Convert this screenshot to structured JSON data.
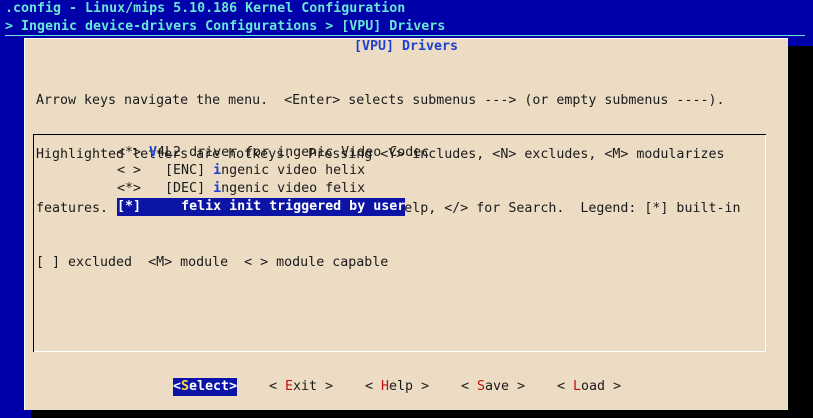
{
  "header": {
    "title": ".config - Linux/mips 5.10.186 Kernel Configuration",
    "breadcrumb": "> Ingenic device-drivers Configurations > [VPU] Drivers"
  },
  "dialog": {
    "title": "[VPU] Drivers",
    "help_lines": [
      "Arrow keys navigate the menu.  <Enter> selects submenus ---> (or empty submenus ----).",
      "Highlighted letters are hotkeys.  Pressing <Y> includes, <N> excludes, <M> modularizes",
      "features.  Press <Esc><Esc> to exit, <?> for Help, </> for Search.  Legend: [*] built-in",
      "[ ] excluded  <M> module  < > module capable"
    ]
  },
  "menu": {
    "items": [
      {
        "state": "<*> ",
        "prefix": "",
        "hotkey": "V",
        "rest": "4L2 driver for ingenic Video Codec"
      },
      {
        "state": "< > ",
        "prefix": "  [ENC] ",
        "hotkey": "i",
        "rest": "ngenic video helix"
      },
      {
        "state": "<*> ",
        "prefix": "  [DEC] ",
        "hotkey": "i",
        "rest": "ngenic video felix"
      },
      {
        "state": "[*] ",
        "prefix": "    ",
        "hotkey": "f",
        "rest": "elix init triggered by user"
      }
    ],
    "selected_index": 3
  },
  "buttons": [
    {
      "pre": "<",
      "hotkey": "S",
      "rest": "elect",
      "post": ">",
      "active": true
    },
    {
      "pre": "< ",
      "hotkey": "E",
      "rest": "xit",
      "post": " >",
      "active": false
    },
    {
      "pre": "< ",
      "hotkey": "H",
      "rest": "elp",
      "post": " >",
      "active": false
    },
    {
      "pre": "< ",
      "hotkey": "S",
      "rest": "ave",
      "post": " >",
      "active": false
    },
    {
      "pre": "< ",
      "hotkey": "L",
      "rest": "oad",
      "post": " >",
      "active": false
    }
  ],
  "colors": {
    "background": "#0000aa",
    "header_text": "#67e8d7",
    "dialog_bg": "#ecdcc4",
    "selection_bg": "#0c14a6",
    "hotkey": "#1d3fcf",
    "button_hotkey": "#c01010"
  }
}
